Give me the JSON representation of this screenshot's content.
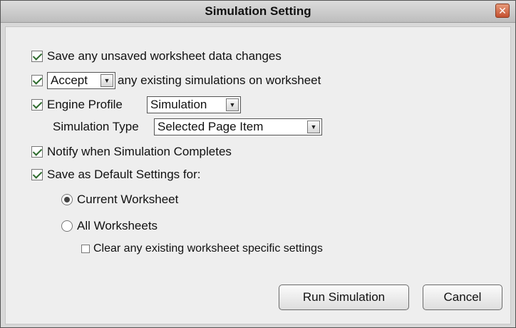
{
  "window": {
    "title": "Simulation Setting",
    "close_glyph": "✕"
  },
  "options": {
    "save_unsaved": {
      "label": "Save any unsaved worksheet data changes",
      "checked": true
    },
    "accept": {
      "checked": true,
      "select_value": "Accept",
      "suffix": "any existing simulations on worksheet"
    },
    "engine_profile": {
      "label": "Engine Profile",
      "checked": true,
      "select_value": "Simulation"
    },
    "simulation_type": {
      "label": "Simulation Type",
      "select_value": "Selected Page Item"
    },
    "notify": {
      "label": "Notify when Simulation Completes",
      "checked": true
    },
    "save_default": {
      "label": "Save as Default Settings for:",
      "checked": true
    },
    "scope_current": {
      "label": "Current Worksheet",
      "selected": true
    },
    "scope_all": {
      "label": "All Worksheets",
      "selected": false
    },
    "clear_specific": {
      "label": "Clear any existing worksheet specific settings",
      "checked": false
    }
  },
  "buttons": {
    "run": "Run Simulation",
    "cancel": "Cancel"
  },
  "icons": {
    "dropdown_arrow": "▼"
  }
}
